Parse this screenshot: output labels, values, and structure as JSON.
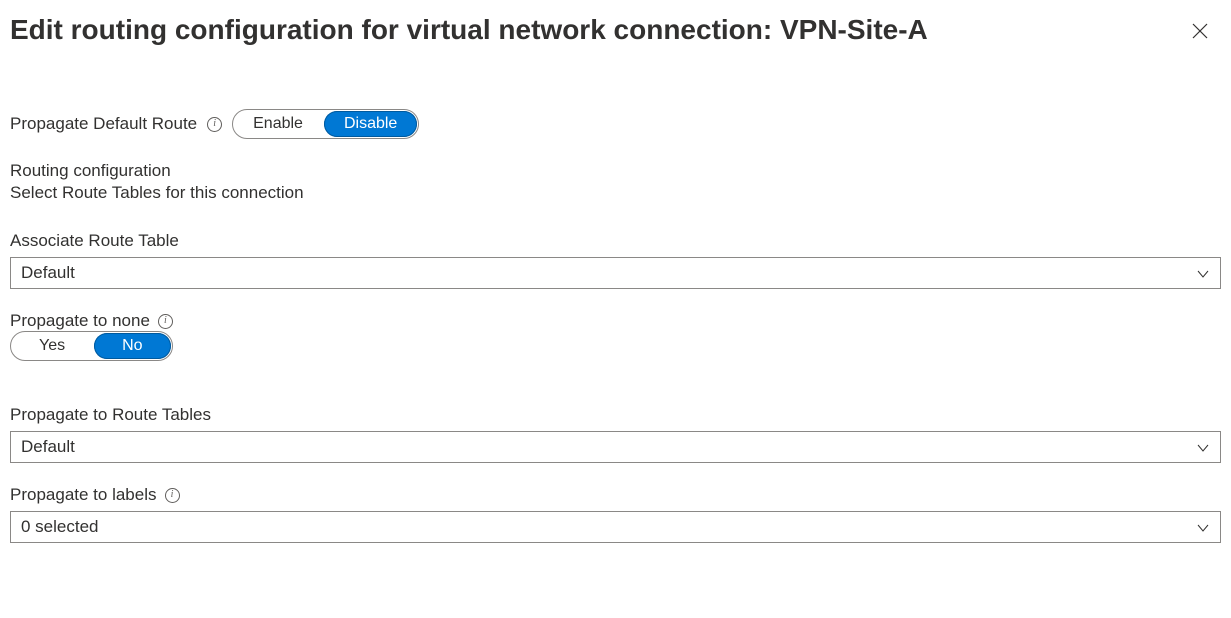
{
  "header": {
    "title": "Edit routing configuration for virtual network connection: VPN-Site-A"
  },
  "propagateDefaultRoute": {
    "label": "Propagate Default Route",
    "options": {
      "enable": "Enable",
      "disable": "Disable"
    },
    "selected": "disable"
  },
  "routingConfig": {
    "heading": "Routing configuration",
    "subheading": "Select Route Tables for this connection"
  },
  "associateRouteTable": {
    "label": "Associate Route Table",
    "value": "Default"
  },
  "propagateToNone": {
    "label": "Propagate to none",
    "options": {
      "yes": "Yes",
      "no": "No"
    },
    "selected": "no"
  },
  "propagateToRouteTables": {
    "label": "Propagate to Route Tables",
    "value": "Default"
  },
  "propagateToLabels": {
    "label": "Propagate to labels",
    "value": "0 selected"
  }
}
